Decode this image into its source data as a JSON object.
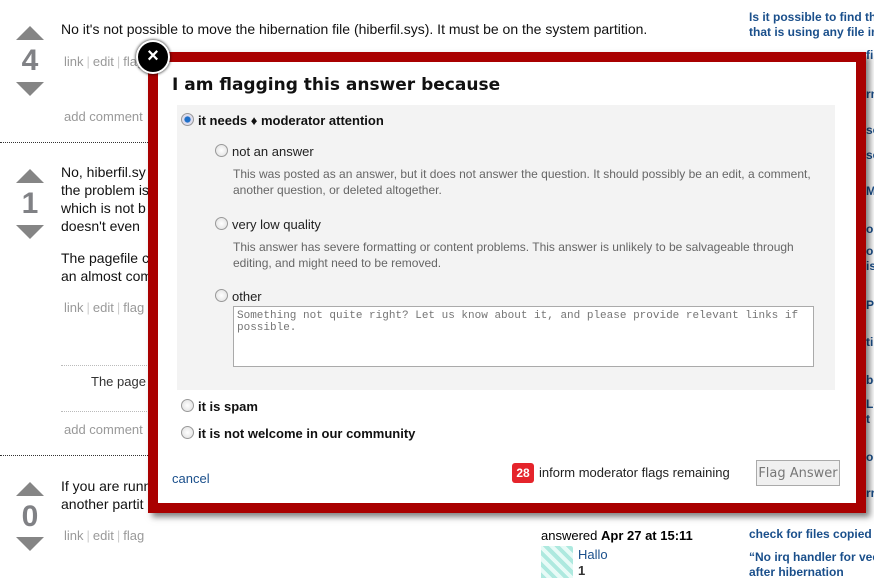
{
  "answers": [
    {
      "votes": "4",
      "text": "No it's not possible to move the hibernation file (hiberfil.sys). It must be on the system partition.",
      "links": [
        "link",
        "edit",
        "flag"
      ],
      "add_comment": "add comment"
    },
    {
      "votes": "1",
      "lines": [
        "No, hiberfil.sy",
        "the problem is",
        "which is not b",
        "doesn't even"
      ],
      "para2": [
        "The pagefile c",
        "an almost com"
      ],
      "links": [
        "link",
        "edit",
        "flag"
      ],
      "comment": "The page",
      "add_comment": "add comment"
    },
    {
      "votes": "0",
      "lines": [
        "If you are runn",
        "another partit"
      ],
      "links": [
        "link",
        "edit",
        "flag"
      ],
      "answered_label": "answered",
      "answered_date": "Apr 27 at 15:11",
      "user": "Hallo",
      "rep": "1"
    }
  ],
  "sidebar": {
    "top": [
      "Is it possible to find th",
      "that is using any file in"
    ],
    "fragments": [
      "fin",
      "rn",
      "so",
      "se",
      "My",
      "om",
      "ou",
      "is",
      "P",
      "ti",
      "be",
      "Lo",
      "t",
      "ob",
      "rr"
    ],
    "bottom1": "check for files copied",
    "bottom2": [
      "“No irq handler for vec",
      "after hibernation"
    ]
  },
  "modal": {
    "close_icon": "×",
    "title": "I am flagging this answer because",
    "moderator": "it needs ♦ moderator attention",
    "sub": [
      {
        "label": "not an answer",
        "desc": "This was posted as an answer, but it does not answer the question. It should possibly be an edit, a comment, another question, or deleted altogether."
      },
      {
        "label": "very low quality",
        "desc": "This answer has severe formatting or content problems. This answer is unlikely to be salvageable through editing, and might need to be removed."
      },
      {
        "label": "other",
        "placeholder": "Something not quite right? Let us know about it, and please provide relevant links if possible."
      }
    ],
    "spam": "it is spam",
    "not_welcome": "it is not welcome in our community",
    "cancel": "cancel",
    "flags_count": "28",
    "flags_text": "inform moderator flags remaining",
    "submit": "Flag Answer"
  },
  "colors": {
    "modal_border": "#a90000",
    "badge": "#e5242b",
    "link": "#1a4f8b"
  }
}
